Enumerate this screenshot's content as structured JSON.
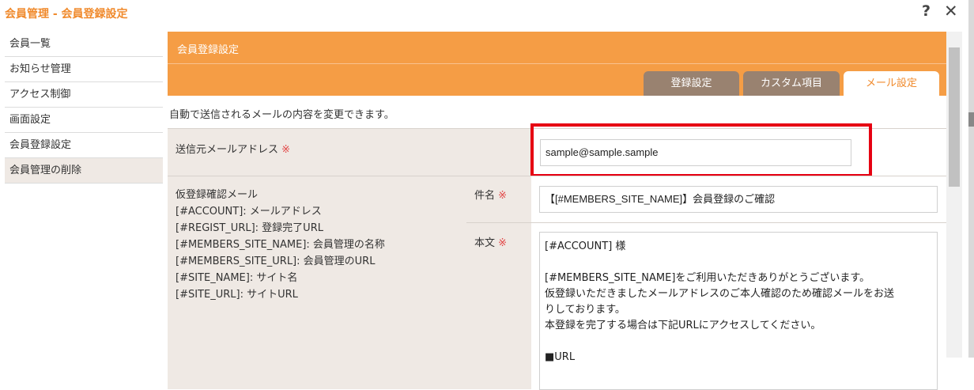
{
  "window": {
    "title": "会員管理 - 会員登録設定",
    "help": "?",
    "close": "✕"
  },
  "sidebar": {
    "items": [
      {
        "label": "会員一覧"
      },
      {
        "label": "お知らせ管理"
      },
      {
        "label": "アクセス制御"
      },
      {
        "label": "画面設定"
      },
      {
        "label": "会員登録設定"
      },
      {
        "label": "会員管理の削除"
      }
    ]
  },
  "header": {
    "title": "会員登録設定"
  },
  "tabs": [
    {
      "label": "登録設定"
    },
    {
      "label": "カスタム項目"
    },
    {
      "label": "メール設定"
    }
  ],
  "description": "自動で送信されるメールの内容を変更できます。",
  "required_mark": "※",
  "sender": {
    "label": "送信元メールアドレス",
    "value": "sample@sample.sample"
  },
  "confirm_mail": {
    "label": "仮登録確認メール",
    "placeholders": [
      "[#ACCOUNT]: メールアドレス",
      "[#REGIST_URL]: 登録完了URL",
      "[#MEMBERS_SITE_NAME]: 会員管理の名称",
      "[#MEMBERS_SITE_URL]: 会員管理のURL",
      "[#SITE_NAME]: サイト名",
      "[#SITE_URL]: サイトURL"
    ],
    "subject": {
      "label": "件名",
      "value": "【[#MEMBERS_SITE_NAME]】会員登録のご確認"
    },
    "body": {
      "label": "本文",
      "lines": [
        "[#ACCOUNT] 様",
        "",
        "[#MEMBERS_SITE_NAME]をご利用いただきありがとうございます。",
        "仮登録いただきましたメールアドレスのご本人確認のため確認メールをお送",
        "りしております。",
        "本登録を完了する場合は下記URLにアクセスしてください。",
        "",
        "■URL"
      ]
    }
  },
  "colors": {
    "accent": "#f59d45",
    "tab_inactive": "#998270",
    "required": "#e24646",
    "highlight": "#e60012"
  }
}
